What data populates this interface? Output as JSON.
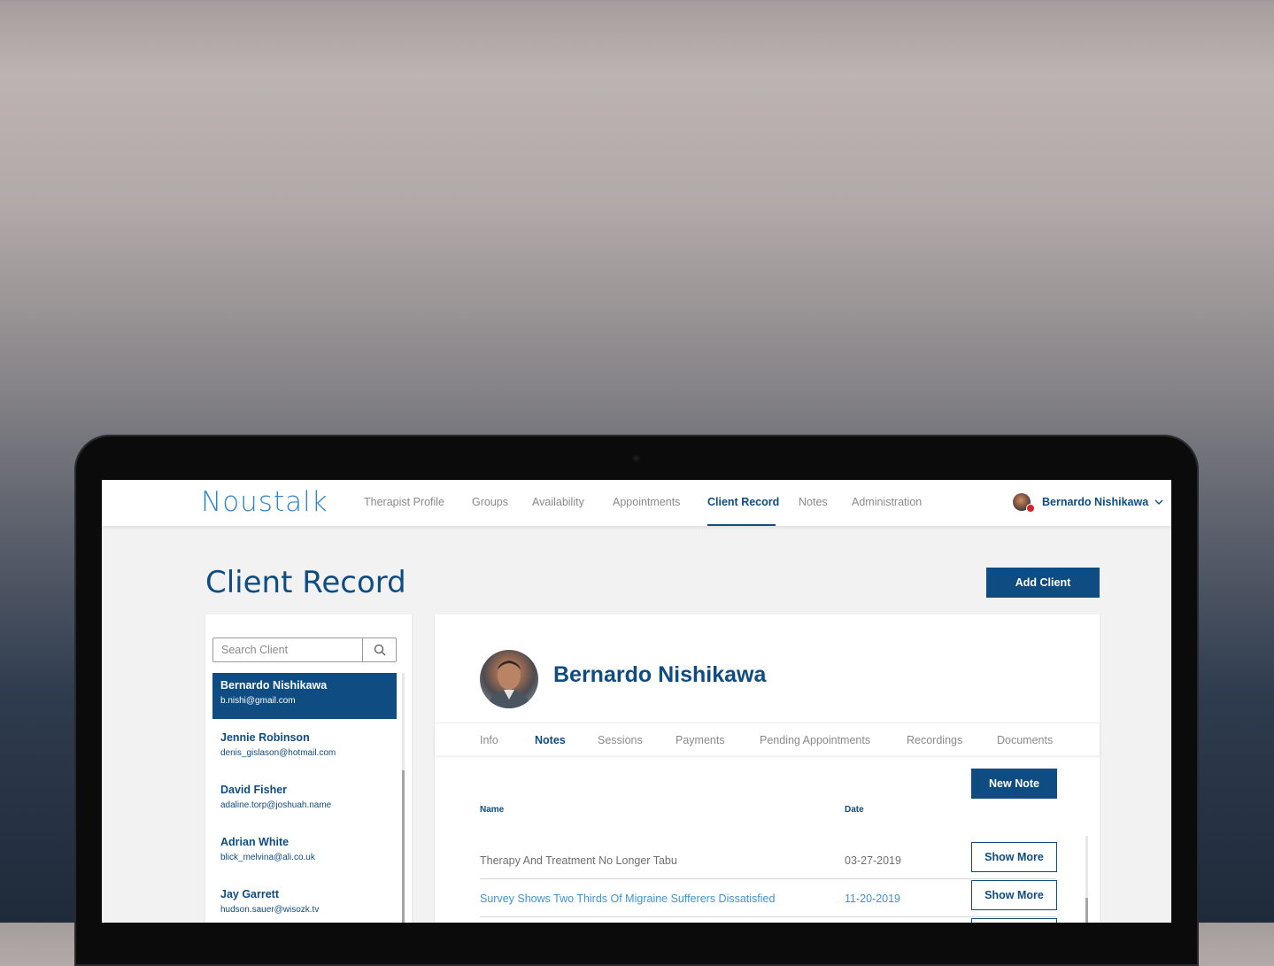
{
  "brand": {
    "logo_text": "Noustalk",
    "primary_color": "#0f4c81",
    "logo_color": "#2f86c4"
  },
  "nav": {
    "items": [
      {
        "label": "Therapist Profile",
        "active": false
      },
      {
        "label": "Groups",
        "active": false
      },
      {
        "label": "Availability",
        "active": false
      },
      {
        "label": "Appointments",
        "active": false
      },
      {
        "label": "Client Record",
        "active": true
      },
      {
        "label": "Notes",
        "active": false
      },
      {
        "label": "Administration",
        "active": false
      }
    ],
    "user": {
      "name": "Bernardo Nishikawa",
      "avatar": "user-avatar",
      "dropdown_icon": "chevron-down-icon",
      "has_notification": true
    }
  },
  "page": {
    "title": "Client Record",
    "add_button": "Add Client"
  },
  "clients": {
    "search_placeholder": "Search Client",
    "search_icon": "search-icon",
    "items": [
      {
        "name": "Bernardo Nishikawa",
        "email": "b.nishi@gmail.com",
        "selected": true
      },
      {
        "name": "Jennie Robinson",
        "email": "denis_gislason@hotmail.com",
        "selected": false
      },
      {
        "name": "David Fisher",
        "email": "adaline.torp@joshuah.name",
        "selected": false
      },
      {
        "name": "Adrian White",
        "email": "blick_melvina@ali.co.uk",
        "selected": false
      },
      {
        "name": "Jay Garrett",
        "email": "hudson.sauer@wisozk.tv",
        "selected": false
      }
    ]
  },
  "record": {
    "client_name": "Bernardo Nishikawa",
    "tabs": [
      {
        "label": "Info",
        "active": false
      },
      {
        "label": "Notes",
        "active": true
      },
      {
        "label": "Sessions",
        "active": false
      },
      {
        "label": "Payments",
        "active": false
      },
      {
        "label": "Pending Appointments",
        "active": false
      },
      {
        "label": "Recordings",
        "active": false
      },
      {
        "label": "Documents",
        "active": false
      }
    ],
    "new_note_button": "New Note",
    "columns": {
      "name": "Name",
      "date": "Date"
    },
    "notes": [
      {
        "name": "Therapy And Treatment No Longer Tabu",
        "date": "03-27-2019",
        "action": "Show More",
        "highlight": false
      },
      {
        "name": "Survey Shows Two Thirds Of Migraine Sufferers Dissatisfied",
        "date": "11-20-2019",
        "action": "Show More",
        "highlight": true
      }
    ]
  }
}
